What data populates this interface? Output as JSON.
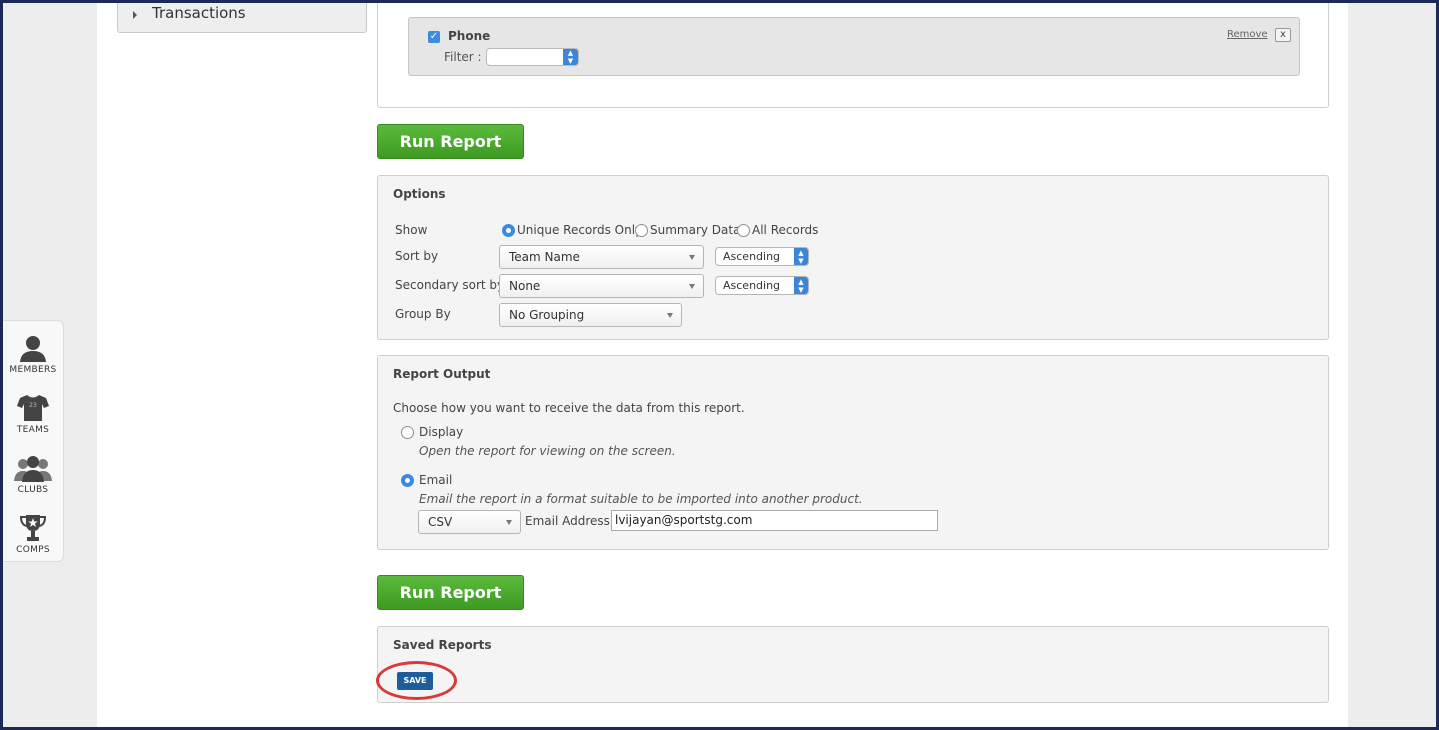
{
  "sidebar": {
    "transactions_label": "Transactions"
  },
  "leftnav": {
    "items": [
      {
        "label": "MEMBERS",
        "icon": "member-icon"
      },
      {
        "label": "TEAMS",
        "icon": "jersey-icon"
      },
      {
        "label": "CLUBS",
        "icon": "group-icon"
      },
      {
        "label": "COMPS",
        "icon": "trophy-icon"
      }
    ]
  },
  "filter": {
    "field_name": "Phone",
    "checked": true,
    "filter_label": "Filter :",
    "filter_value": "",
    "remove_label": "Remove",
    "close_label": "x"
  },
  "run_report_label": "Run Report",
  "options": {
    "title": "Options",
    "show_label": "Show",
    "show_options": [
      "Unique Records Only",
      "Summary Data",
      "All Records"
    ],
    "show_selected": "Unique Records Only",
    "sort_by_label": "Sort by",
    "sort_by_value": "Team Name",
    "sort_by_order": "Ascending",
    "secondary_sort_label": "Secondary sort by",
    "secondary_sort_value": "None",
    "secondary_sort_order": "Ascending",
    "group_by_label": "Group By",
    "group_by_value": "No Grouping"
  },
  "output": {
    "title": "Report Output",
    "intro": "Choose how you want to receive the data from this report.",
    "display_label": "Display",
    "display_desc": "Open the report for viewing on the screen.",
    "email_label": "Email",
    "email_desc": "Email the report in a format suitable to be imported into another product.",
    "selected": "Email",
    "format_value": "CSV",
    "email_address_label": "Email Address",
    "email_address_value": "lvijayan@sportstg.com"
  },
  "saved_reports": {
    "title": "Saved Reports",
    "save_label": "SAVE"
  },
  "colors": {
    "run_button": "#4aa82c",
    "save_button": "#1f5d9a",
    "highlight_ring": "#d83a3a",
    "frame": "#1c2a55"
  }
}
